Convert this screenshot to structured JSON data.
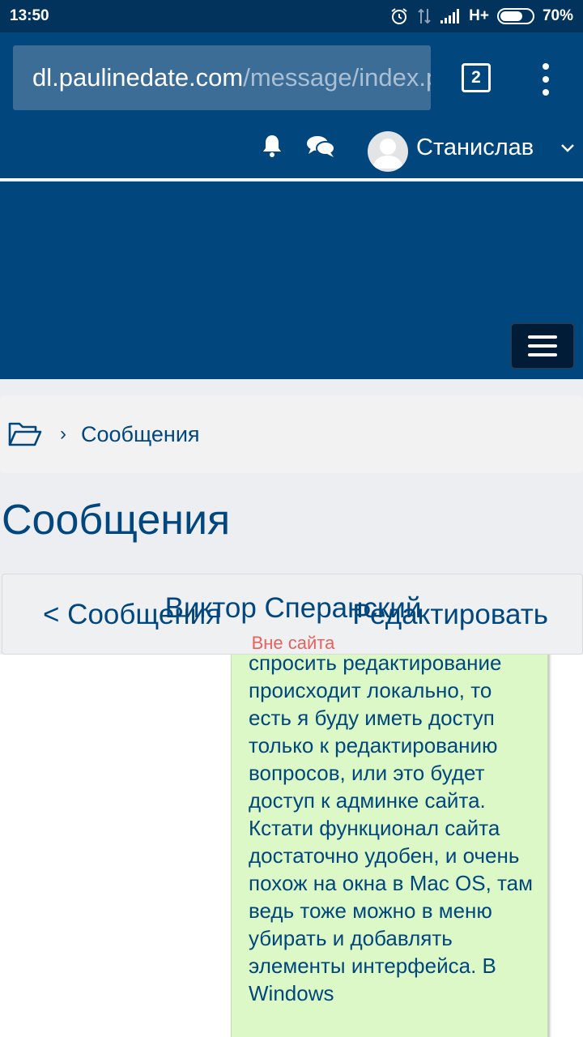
{
  "status_bar": {
    "time": "13:50",
    "network": "H+",
    "battery_percent": "70%",
    "battery_level": 0.7
  },
  "browser": {
    "url_host": "dl.paulinedate.com",
    "url_path": "/message/index.php",
    "tab_count": "2"
  },
  "navbar": {
    "username": "Станислав"
  },
  "breadcrumb": {
    "label": "Сообщения"
  },
  "page": {
    "title": "Сообщения"
  },
  "conversation": {
    "back_label": "< Сообщения",
    "contact_name": "Виктор Сперанский",
    "edit_label": "Редактировать",
    "contact_status": "Вне сайта",
    "message_text": "спросить редактирование происходит локально, то есть я буду иметь доступ только к редактированию вопросов, или это будет доступ к админке сайта. Кстати функционал сайта достаточно удобен, и очень похож на окна в Mac OS, там ведь тоже можно в меню убирать и добавлять элементы интерфейса. В Windows"
  },
  "colors": {
    "brand_blue": "#01477d",
    "status_bar_bg": "#01335d",
    "message_bubble": "#dcf8c6",
    "offline_status": "#e86060"
  },
  "icons": {
    "alarm": "alarm-icon",
    "signal": "signal-icon",
    "notification": "bell-icon",
    "messages": "chat-bubbles-icon",
    "user": "avatar-icon",
    "dropdown": "chevron-down-icon",
    "menu": "hamburger-icon",
    "home": "folder-open-icon"
  }
}
